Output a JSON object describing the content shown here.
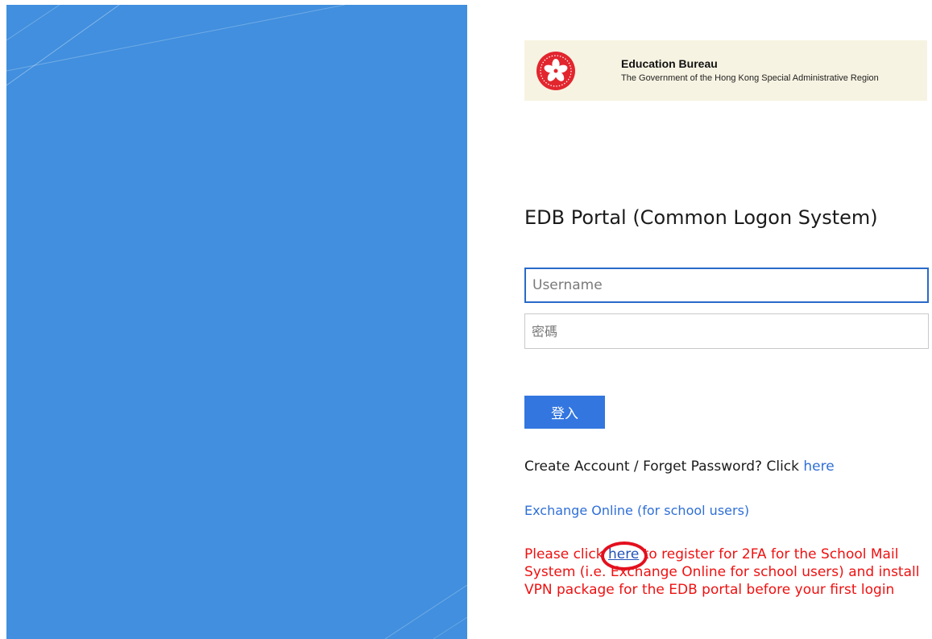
{
  "banner": {
    "title": "Education Bureau",
    "subtitle": "The Government of the Hong Kong Special Administrative Region",
    "emblem_icon": "hksar-bauhinia-emblem-icon"
  },
  "login": {
    "title": "EDB Portal (Common Logon System)",
    "username_placeholder": "Username",
    "password_placeholder": "密碼",
    "submit_label": "登入"
  },
  "links": {
    "account_prefix": "Create Account / Forget Password? Click",
    "account_link": "here",
    "exchange_online": "Exchange Online (for school users)"
  },
  "notice": {
    "prefix": "Please click",
    "link": "here",
    "suffix": "to register for 2FA for the School Mail System (i.e. Exchange Online for school users) and install VPN package for the EDB portal before your first login"
  },
  "colors": {
    "left_panel": "#418fde",
    "primary_button": "#3376e0",
    "link": "#2f6fd6",
    "notice_text": "#ee1111",
    "highlight_circle": "#e3101e"
  }
}
